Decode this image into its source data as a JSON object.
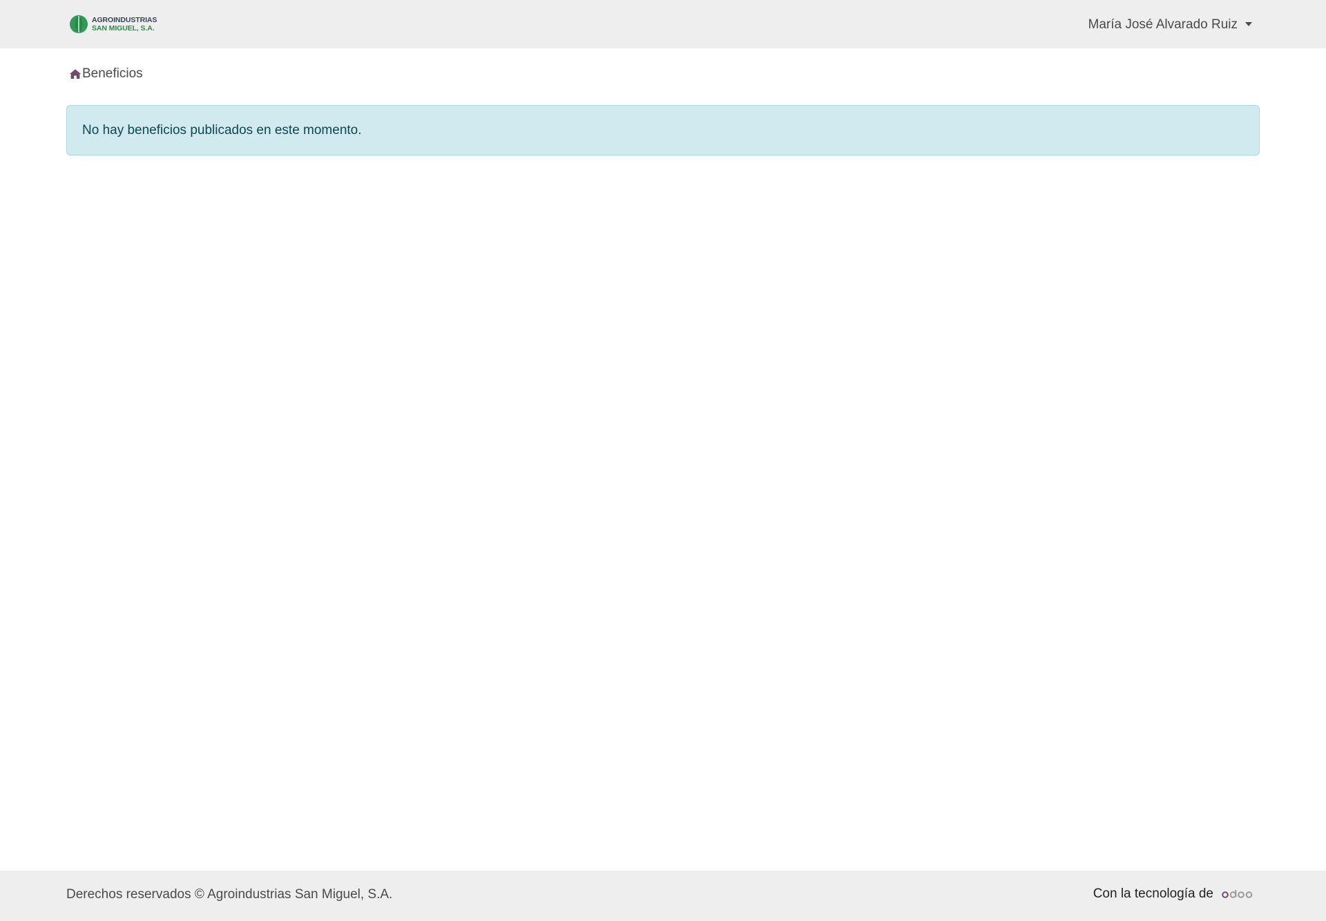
{
  "header": {
    "logo": {
      "line1": "AGROINDUSTRIAS",
      "line2": "SAN MIGUEL, S.A.",
      "colors": {
        "mark": "#2e9a56",
        "text_top": "#3a3f55",
        "text_bottom": "#2f8a4a"
      }
    },
    "user_menu": {
      "name": "María José Alvarado Ruiz",
      "icon": "caret-down-icon"
    }
  },
  "breadcrumb": {
    "home_icon": "home-icon",
    "current": "Beneficios"
  },
  "alert": {
    "message": "No hay beneficios publicados en este momento.",
    "colors": {
      "background": "#d0eaf0",
      "border": "#a9d8df",
      "text": "#0f4650"
    }
  },
  "footer": {
    "copyright": "Derechos reservados © Agroindustrias San Miguel, S.A.",
    "powered_by_label": "Con la tecnología de",
    "powered_by_logo": "odoo",
    "colors": {
      "background": "#eeeeee"
    }
  },
  "theme": {
    "navbar_bg": "#eeeeee",
    "accent": "#714b67"
  }
}
